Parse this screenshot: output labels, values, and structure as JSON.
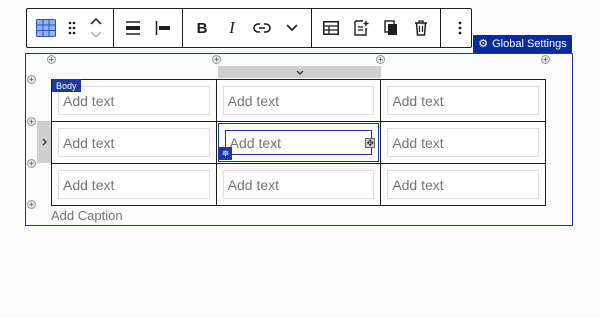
{
  "toolbar": {
    "groups": [
      {
        "name": "block",
        "items": [
          "table-block-icon",
          "drag-handle-icon",
          "move-up-down-icon"
        ]
      },
      {
        "name": "alignment",
        "items": [
          "align-wide-icon",
          "align-left-icon"
        ]
      },
      {
        "name": "formatting",
        "items": [
          "bold",
          "italic",
          "link-icon",
          "more-formatting-chevron-icon"
        ]
      },
      {
        "name": "table-actions",
        "items": [
          "edit-table-icon",
          "insert-icon",
          "duplicate-icon",
          "trash-icon"
        ]
      },
      {
        "name": "options",
        "items": [
          "more-options-icon"
        ]
      }
    ],
    "bold_label": "B",
    "italic_label": "I"
  },
  "global_settings": {
    "label": "Global Settings",
    "icon": "gear-icon"
  },
  "table": {
    "section_label": "Body",
    "placeholder": "Add text",
    "rows": [
      [
        "Add text",
        "Add text",
        "Add text"
      ],
      [
        "Add text",
        "Add text",
        "Add text"
      ],
      [
        "Add text",
        "Add text",
        "Add text"
      ]
    ],
    "active_cell": {
      "row": 2,
      "column": 2
    }
  },
  "caption": {
    "placeholder": "Add Caption"
  },
  "colors": {
    "accent": "#1f3a9e",
    "global_settings_bg": "#0a2aa0",
    "placeholder_text": "#757575",
    "border": "#1e1e1e"
  }
}
